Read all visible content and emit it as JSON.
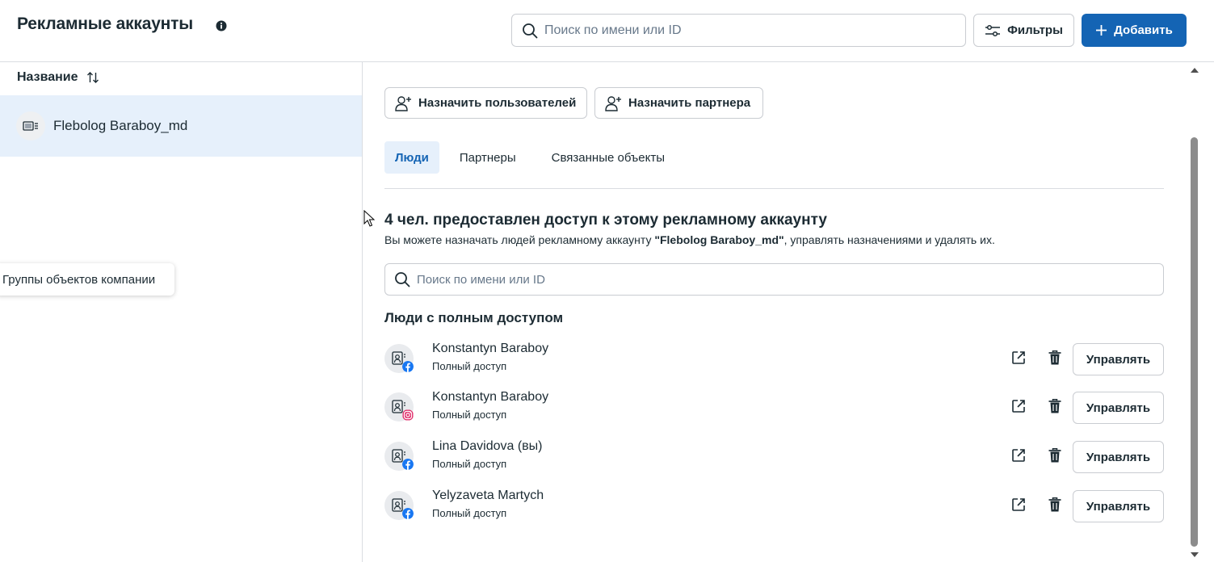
{
  "header": {
    "title": "Рекламные аккаунты",
    "search_placeholder": "Поиск по имени или ID",
    "filters_label": "Фильтры",
    "add_label": "Добавить"
  },
  "left_panel": {
    "column_header": "Название",
    "accounts": [
      {
        "name": "Flebolog Baraboy_md",
        "selected": true
      }
    ],
    "tooltip": "Группы объектов компании"
  },
  "right_panel": {
    "assign_users_label": "Назначить пользователей",
    "assign_partner_label": "Назначить партнера",
    "tabs": [
      {
        "label": "Люди",
        "active": true
      },
      {
        "label": "Партнеры",
        "active": false
      },
      {
        "label": "Связанные объекты",
        "active": false
      }
    ],
    "section_title": "4 чел. предоставлен доступ к этому рекламному аккаунту",
    "section_desc_prefix": "Вы можете назначать людей рекламному аккаунту ",
    "section_desc_account": "\"Flebolog Baraboy_md\"",
    "section_desc_suffix": ", управлять назначениями и удалять их.",
    "search_placeholder": "Поиск по имени или ID",
    "group_title": "Люди с полным доступом",
    "manage_label": "Управлять",
    "people": [
      {
        "name": "Konstantyn Baraboy",
        "access": "Полный доступ",
        "platform": "facebook"
      },
      {
        "name": "Konstantyn Baraboy",
        "access": "Полный доступ",
        "platform": "instagram"
      },
      {
        "name": "Lina Davidova (вы)",
        "access": "Полный доступ",
        "platform": "facebook"
      },
      {
        "name": "Yelyzaveta Martych",
        "access": "Полный доступ",
        "platform": "facebook"
      }
    ]
  },
  "colors": {
    "accent": "#1464b4",
    "selected_bg": "#e6f0fb",
    "facebook": "#1877f2"
  }
}
